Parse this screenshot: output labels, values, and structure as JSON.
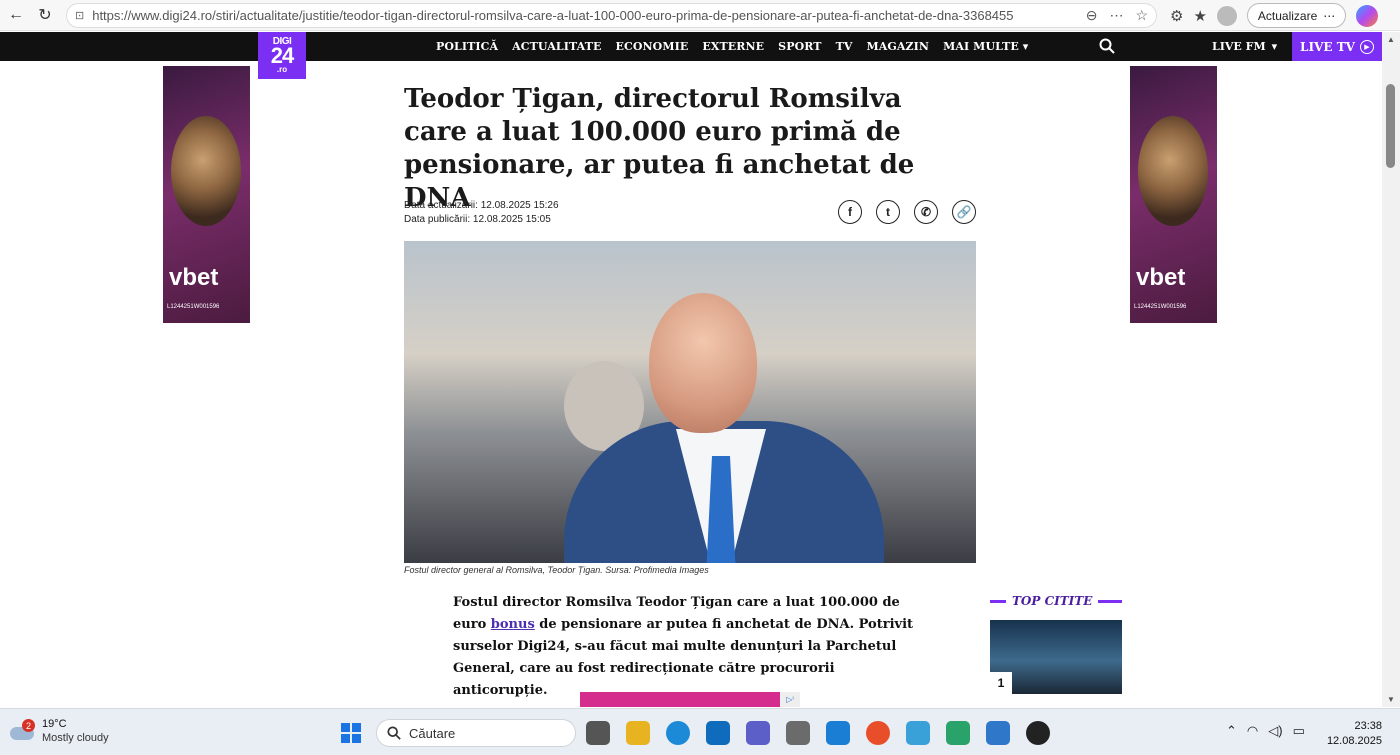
{
  "browser": {
    "url": "https://www.digi24.ro/stiri/actualitate/justitie/teodor-tigan-directorul-romsilva-care-a-luat-100-000-euro-prima-de-pensionare-ar-putea-fi-anchetat-de-dna-3368455",
    "update_label": "Actualizare"
  },
  "site": {
    "logo_top": "DIGI",
    "logo_main": "24",
    "logo_tld": ".ro",
    "menu": [
      "POLITICĂ",
      "ACTUALITATE",
      "ECONOMIE",
      "EXTERNE",
      "SPORT",
      "TV",
      "MAGAZIN",
      "MAI MULTE"
    ],
    "live_fm": "LIVE FM",
    "live_tv": "LIVE TV",
    "accent": "#7b2ff2"
  },
  "ads": {
    "brand": "vbet",
    "license": "L1244251W001596"
  },
  "article": {
    "title": "Teodor Țigan, directorul Romsilva care a luat 100.000 euro primă de pensionare, ar putea fi anchetat de DNA",
    "updated": "Data actualizării: 12.08.2025 15:26",
    "published": "Data publicării: 12.08.2025 15:05",
    "share_icons": [
      "facebook-icon",
      "twitter-icon",
      "whatsapp-icon",
      "link-icon"
    ],
    "caption": "Fostul director general al Romsilva, Teodor Țigan. Sursa: Profimedia Images",
    "lead_before": "Fostul director Romsilva Teodor Țigan care a luat 100.000 de euro ",
    "lead_link": "bonus",
    "lead_after": " de pensionare ar putea fi anchetat de DNA. Potrivit surselor Digi24, s-au făcut mai multe denunțuri la Parchetul General, care au fost redirecționate către procurorii anticorupție."
  },
  "sidebar": {
    "top_label": "TOP CITITE",
    "top_first_rank": "1"
  },
  "taskbar": {
    "temperature": "19°C",
    "weather": "Mostly cloudy",
    "weather_badge": "2",
    "search_placeholder": "Căutare",
    "time": "23:38",
    "date": "12.08.2025"
  }
}
